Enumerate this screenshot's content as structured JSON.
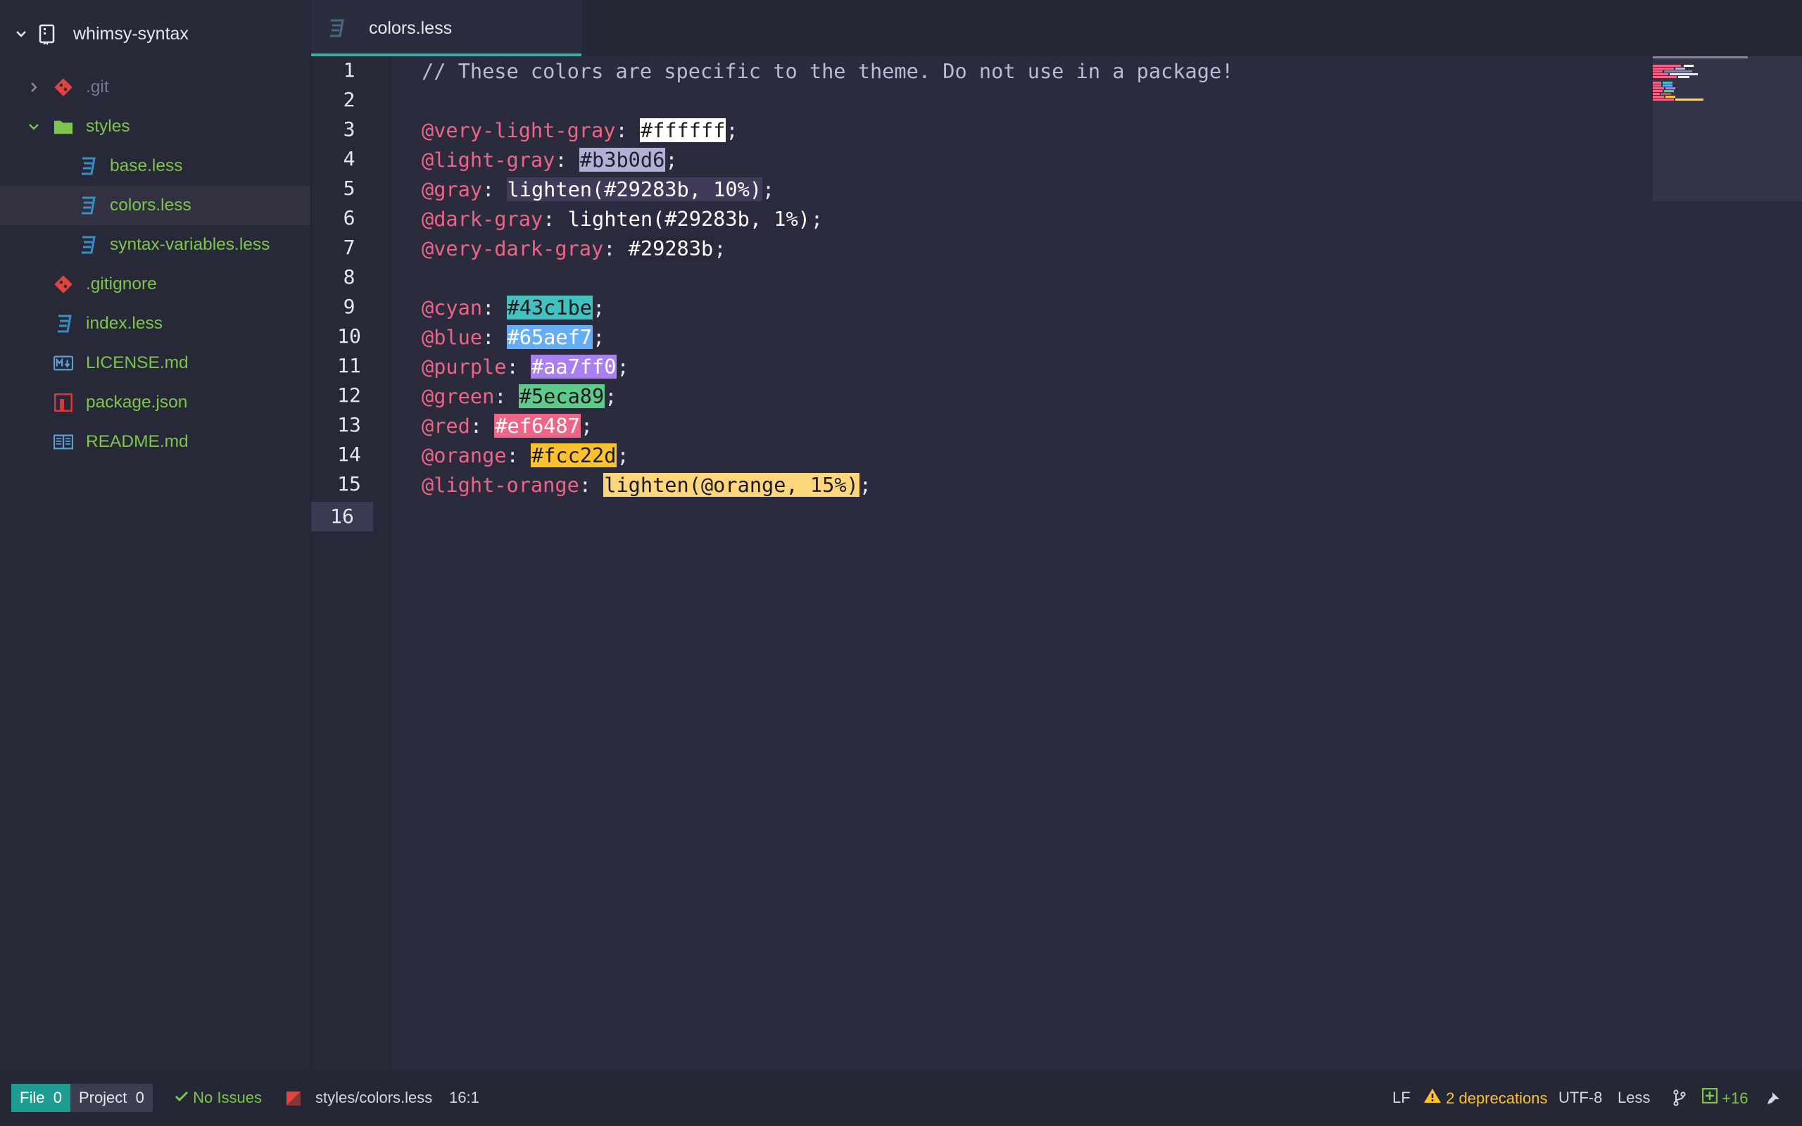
{
  "colors": {
    "accent": "#3ab1a5",
    "green": "#7ec54c",
    "pink": "#ef6487",
    "yellow": "#fcc22d",
    "bg": "#292a3b"
  },
  "tree": {
    "root": {
      "label": "whimsy-syntax",
      "icon": "repo-icon"
    },
    "items": [
      {
        "label": ".git",
        "icon": "git-icon",
        "kind": "folder",
        "expanded": false
      },
      {
        "label": "styles",
        "icon": "folder-icon",
        "kind": "folder",
        "expanded": true
      },
      {
        "label": "base.less",
        "icon": "css3-icon",
        "kind": "file"
      },
      {
        "label": "colors.less",
        "icon": "css3-icon",
        "kind": "file",
        "selected": true
      },
      {
        "label": "syntax-variables.less",
        "icon": "css3-icon",
        "kind": "file"
      },
      {
        "label": ".gitignore",
        "icon": "git-icon",
        "kind": "file"
      },
      {
        "label": "index.less",
        "icon": "css3-icon",
        "kind": "file"
      },
      {
        "label": "LICENSE.md",
        "icon": "markdown-icon",
        "kind": "file"
      },
      {
        "label": "package.json",
        "icon": "npm-icon",
        "kind": "file"
      },
      {
        "label": "README.md",
        "icon": "book-icon",
        "kind": "file"
      }
    ]
  },
  "tab": {
    "title": "colors.less",
    "icon": "css3-icon"
  },
  "editor": {
    "line_numbers": [
      "1",
      "2",
      "3",
      "4",
      "5",
      "6",
      "7",
      "8",
      "9",
      "10",
      "11",
      "12",
      "13",
      "14",
      "15",
      "16"
    ],
    "current_line": "16",
    "lines": {
      "l1": "// These colors are specific to the theme. Do not use in a package!",
      "l3": {
        "name": "@very-light-gray",
        "value": "#ffffff",
        "swatch": "#ffffff"
      },
      "l4": {
        "name": "@light-gray",
        "value": "#b3b0d6",
        "swatch": "#b3b0d6"
      },
      "l5": {
        "name": "@gray",
        "value": "lighten(#29283b, 10%)",
        "swatch": "#3e3c59"
      },
      "l6": {
        "name": "@dark-gray",
        "value": "lighten(#29283b, 1%)",
        "swatch": "#2b2a3e"
      },
      "l7": {
        "name": "@very-dark-gray",
        "value": "#29283b",
        "swatch": "#29283b"
      },
      "l9": {
        "name": "@cyan",
        "value": "#43c1be",
        "swatch": "#43c1be"
      },
      "l10": {
        "name": "@blue",
        "value": "#65aef7",
        "swatch": "#65aef7"
      },
      "l11": {
        "name": "@purple",
        "value": "#aa7ff0",
        "swatch": "#aa7ff0"
      },
      "l12": {
        "name": "@green",
        "value": "#5eca89",
        "swatch": "#5eca89"
      },
      "l13": {
        "name": "@red",
        "value": "#ef6487",
        "swatch": "#ef6487"
      },
      "l14": {
        "name": "@orange",
        "value": "#fcc22d",
        "swatch": "#fcc22d"
      },
      "l15": {
        "name": "@light-orange",
        "value": "lighten(@orange, 15%)",
        "swatch": "#fdd57a"
      }
    },
    "colon": ": ",
    "semi": ";"
  },
  "status": {
    "file_label": "File",
    "file_count": "0",
    "project_label": "Project",
    "project_count": "0",
    "issues": "No Issues",
    "path": "styles/colors.less",
    "cursor": "16:1",
    "line_ending": "LF",
    "deprecations": "2 deprecations",
    "encoding": "UTF-8",
    "grammar": "Less",
    "git_diff": "+16"
  }
}
